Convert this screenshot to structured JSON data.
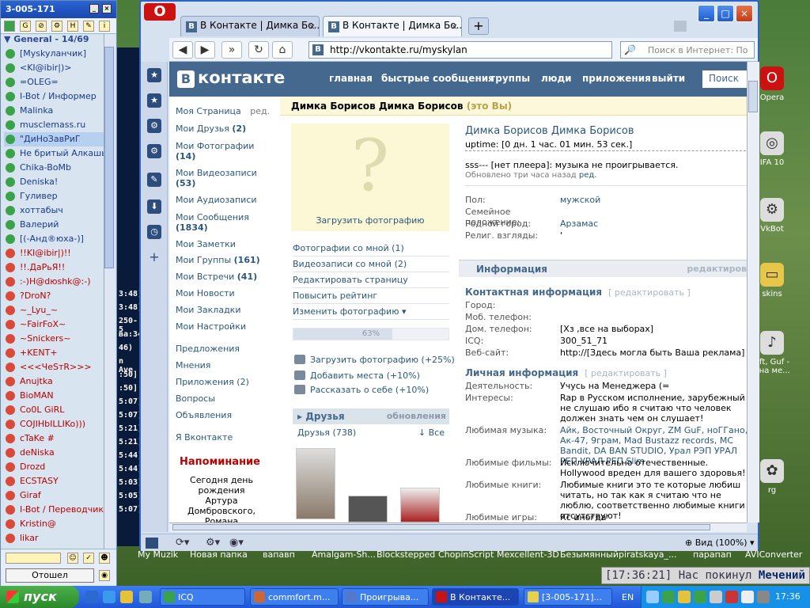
{
  "icq": {
    "title": "3-005-171",
    "group": "General - 14/69",
    "contacts": [
      {
        "name": "[Myskyланчик]",
        "state": "on"
      },
      {
        "name": "<KI@ibir|)>",
        "state": "on"
      },
      {
        "name": "=OLEG=",
        "state": "on"
      },
      {
        "name": "I-Bot / Информер",
        "state": "on"
      },
      {
        "name": "Malinka",
        "state": "on"
      },
      {
        "name": "musclemass.ru",
        "state": "on"
      },
      {
        "name": "\"ДиНоЗавРиГ",
        "state": "on",
        "selected": true
      },
      {
        "name": "Не бритый Алкашь",
        "state": "on"
      },
      {
        "name": "Chika-BoMb",
        "state": "on"
      },
      {
        "name": "Deniska!",
        "state": "on"
      },
      {
        "name": "Гуливер",
        "state": "on"
      },
      {
        "name": "хоттабыч",
        "state": "on"
      },
      {
        "name": "Валерий",
        "state": "on"
      },
      {
        "name": "[(-Анд®юха-)]",
        "state": "on"
      },
      {
        "name": "!!KI@ibir|)!!",
        "state": "off"
      },
      {
        "name": "!!.ДаРьЯ!!",
        "state": "off"
      },
      {
        "name": ":-)H@dюshk@:-)",
        "state": "off"
      },
      {
        "name": "?DroN?",
        "state": "off"
      },
      {
        "name": "~_Lyu_~",
        "state": "off"
      },
      {
        "name": "~FairFoX~",
        "state": "off"
      },
      {
        "name": "~Snickers~",
        "state": "off"
      },
      {
        "name": "+KENT+",
        "state": "off"
      },
      {
        "name": "<<<ЧeSтR>>>",
        "state": "off"
      },
      {
        "name": "Anujtka",
        "state": "off"
      },
      {
        "name": "BioMAN",
        "state": "off"
      },
      {
        "name": "Co0L GiRL",
        "state": "off"
      },
      {
        "name": "COJIHbILLIKo)))",
        "state": "off"
      },
      {
        "name": "cTaKe #",
        "state": "off"
      },
      {
        "name": "deNiska",
        "state": "off"
      },
      {
        "name": "Drozd",
        "state": "off"
      },
      {
        "name": "ECSTASY",
        "state": "off"
      },
      {
        "name": "Giraf",
        "state": "off"
      },
      {
        "name": "I-Bot / Переводчик",
        "state": "off"
      },
      {
        "name": "Kristin@",
        "state": "off"
      },
      {
        "name": "likar",
        "state": "off"
      }
    ],
    "status_button": "Отошел"
  },
  "chat_times": [
    "3:48]",
    "3:48]",
    "250-5",
    "ва:34",
    "46)",
    "n Ave",
    ":50]",
    ":50]",
    "5:07]",
    "5:07]",
    "5:21]",
    "5:21]",
    "5:44]",
    "5:44]",
    "5:03]",
    "5:05]",
    "5:07]"
  ],
  "desktop_icons": [
    "Opera",
    "IFA 10",
    "VkBot",
    "skins",
    "aft, Guf - ина ме...",
    "rg"
  ],
  "desktop_labels": [
    "My Muzik",
    "Новая папка",
    "вапавп",
    "Amalgam-Sh...",
    "Blockstepped",
    "ChopinScript",
    "Mexcellent-3D",
    "Безымянный",
    "piratskaya_...",
    "парапап",
    "AVIConverter"
  ],
  "notice": {
    "time": "[17:36:21]",
    "text": "Нас покинул",
    "name": "Мечений"
  },
  "browser": {
    "tabs": [
      {
        "label": "В Контакте | Димка Бо...",
        "active": false
      },
      {
        "label": "В Контакте | Димка Бо...",
        "active": true
      }
    ],
    "url": "http://vkontakte.ru/myskylan",
    "search_placeholder": "Поиск в Интернет: По",
    "zoom": "Вид (100%)"
  },
  "vk": {
    "logo": "контакте",
    "nav": [
      "главная",
      "быстрые сообщения",
      "группы",
      "люди",
      "приложения",
      "выйти"
    ],
    "search_btn": "Поиск",
    "menu": [
      {
        "label": "Моя Страница",
        "extra": "ред."
      },
      {
        "label": "Мои Друзья",
        "count": "(2)"
      },
      {
        "label": "Мои Фотографии",
        "count": "(14)"
      },
      {
        "label": "Мои Видеозаписи",
        "count": "(53)"
      },
      {
        "label": "Мои Аудиозаписи"
      },
      {
        "label": "Мои Сообщения",
        "count": "(1834)"
      },
      {
        "label": "Мои Заметки"
      },
      {
        "label": "Мои Группы",
        "count": "(161)"
      },
      {
        "label": "Мои Встречи",
        "count": "(41)"
      },
      {
        "label": "Мои Новости"
      },
      {
        "label": "Мои Закладки"
      },
      {
        "label": "Мои Настройки"
      }
    ],
    "menu2": [
      "Предложения",
      "Мнения",
      "Приложения (2)",
      "Вопросы",
      "Объявления"
    ],
    "menu3": "Я Вконтакте",
    "reminder_title": "Напоминание",
    "reminder_text": "Сегодня день рождения Артура Домбровского, Романа Анатольевича",
    "header_name": "Димка Борисов Димка Борисов",
    "header_you": "(это Вы)",
    "upload_photo": "Загрузить фотографию",
    "actions": [
      "Фотографии со мной (1)",
      "Видеозаписи со мной (2)",
      "Редактировать страницу",
      "Повысить рейтинг",
      "Изменить фотографию ▾"
    ],
    "progress_text": "63%",
    "progress_value": 63,
    "bonuses": [
      "Загрузить фотографию (+25%)",
      "Добавить места (+10%)",
      "Рассказать о себе (+10%)"
    ],
    "friends_title": "Друзья",
    "friends_updates": "обновления",
    "friends_count": "Друзья (738)",
    "friends_all": "↓ Все",
    "profile_name": "Димка Борисов Димка Борисов",
    "uptime": "uptime: [0 дн. 1 час. 01 мин. 53 сек.]",
    "status": "sss--- [нет плеера]: музыка не проигрывается.",
    "updated": "Обновлено три часа назад",
    "updated_red": "ред.",
    "basic": [
      {
        "k": "Пол:",
        "v": "мужской"
      },
      {
        "k": "Семейное положение:",
        "v": ""
      },
      {
        "k": "Родной город:",
        "v": "Арзамас"
      },
      {
        "k": "Религ. взгляды:",
        "v": "'"
      }
    ],
    "info_title": "Информация",
    "info_edit": "редактиров",
    "contact_title": "Контактная информация",
    "contact_edit": "[ редактировать ]",
    "contact": [
      {
        "k": "Город:",
        "v": ""
      },
      {
        "k": "Моб. телефон:",
        "v": ""
      },
      {
        "k": "Дом. телефон:",
        "v": "[Хз ,все на выборах]"
      },
      {
        "k": "ICQ:",
        "v": "300_51_71"
      },
      {
        "k": "Веб-сайт:",
        "v": "http://[Здесь могла быть Ваша реклама]"
      }
    ],
    "personal_title": "Личная информация",
    "personal_edit": "[ редактировать ]",
    "personal": [
      {
        "k": "Деятельность:",
        "v": "Учусь на Менеджера (="
      },
      {
        "k": "Интересы:",
        "v": "Rap в Русском исполнение, зарубежный не слушаю ибо я считаю что человек должен знать чем он слушает!"
      },
      {
        "k": "Любимая музыка:",
        "v": "Айк, Восточный Округ, ZM GuF, ноГГано, Ак-47, 9грам, Mad Bustazz records, MC Bandit, DA BAN STUDIO, Урал РЭП УРАЛ РЕП УРАЛ РЕП Slim"
      },
      {
        "k": "Любимые фильмы:",
        "v": "Исключительно отечественные. Hollywood вреден для вашего здоровья!"
      },
      {
        "k": "Любимые книги:",
        "v": "Любимые книги это те которые любиш читать, но так как я считаю что не люблю, соответственно любимые книги отсутствуют!"
      },
      {
        "k": "Любимые игры:",
        "v": "Кс иногда"
      }
    ]
  },
  "taskbar": {
    "start": "пуск",
    "tasks": [
      "ICQ",
      "commfort.m...",
      "Проигрыва...",
      "В Контакте...",
      "[3-005-171]..."
    ],
    "lang": "EN",
    "clock": "17:36"
  }
}
